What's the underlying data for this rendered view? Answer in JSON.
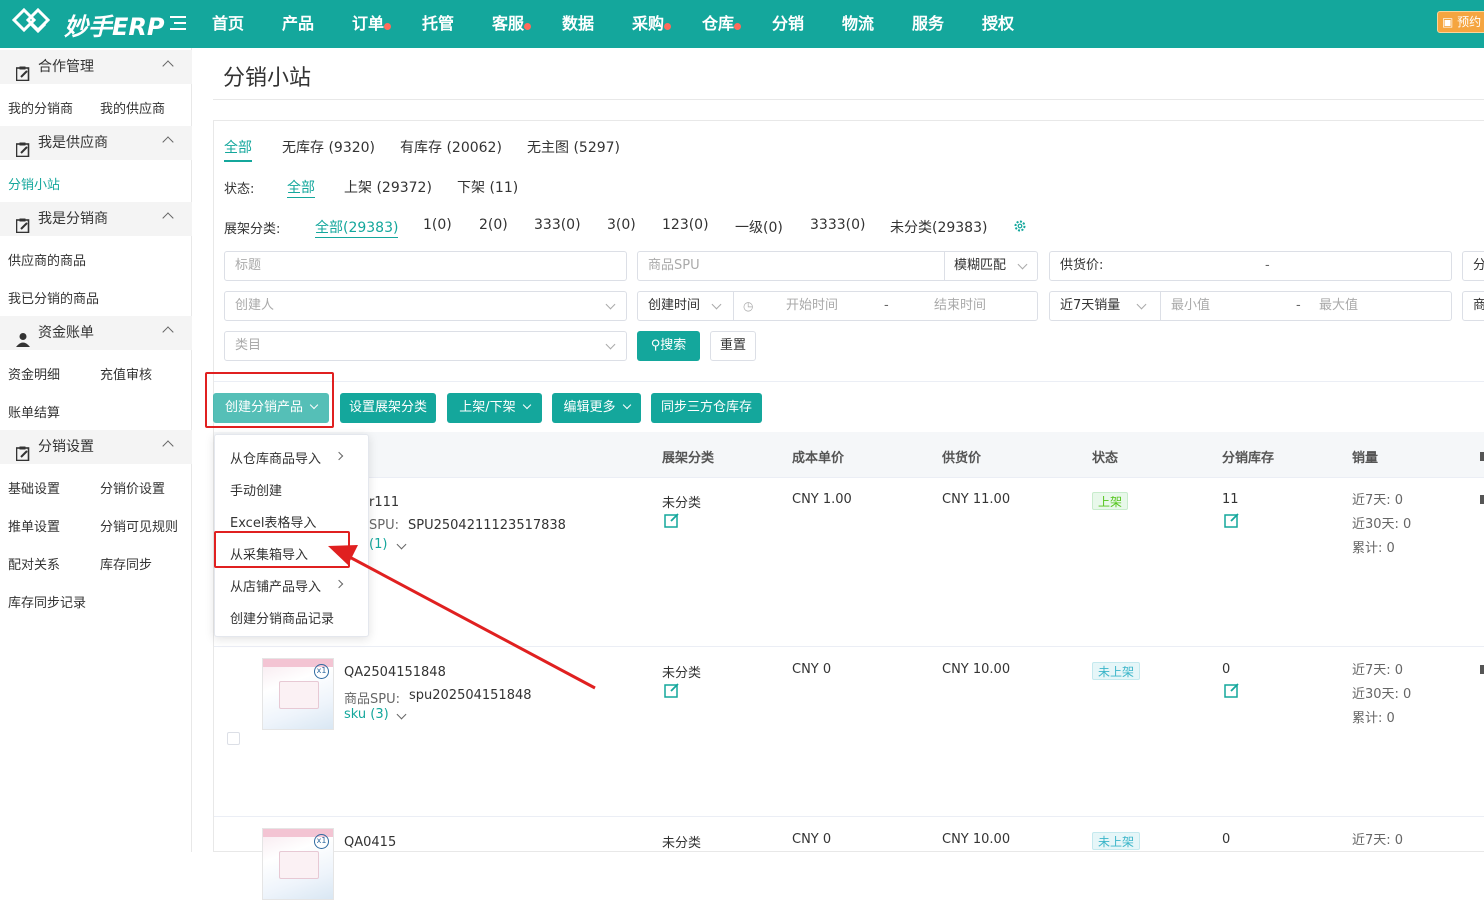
{
  "app": {
    "brand": "妙手ERP",
    "warn_label": "预约"
  },
  "nav": [
    {
      "label": "首页",
      "dot": false
    },
    {
      "label": "产品",
      "dot": false
    },
    {
      "label": "订单",
      "dot": true
    },
    {
      "label": "托管",
      "dot": false
    },
    {
      "label": "客服",
      "dot": true
    },
    {
      "label": "数据",
      "dot": false
    },
    {
      "label": "采购",
      "dot": true
    },
    {
      "label": "仓库",
      "dot": true
    },
    {
      "label": "分销",
      "dot": false
    },
    {
      "label": "物流",
      "dot": false
    },
    {
      "label": "服务",
      "dot": false
    },
    {
      "label": "授权",
      "dot": false
    }
  ],
  "sidebar": {
    "sections": [
      {
        "title": "合作管理",
        "icon": "clipboard-icon",
        "items": [
          "我的分销商",
          "我的供应商"
        ]
      },
      {
        "title": "我是供应商",
        "icon": "clipboard-icon",
        "items": [
          "分销小站"
        ]
      },
      {
        "title": "我是分销商",
        "icon": "clipboard-icon",
        "items": [
          "供应商的商品",
          "我已分销的商品"
        ]
      },
      {
        "title": "资金账单",
        "icon": "user-icon",
        "items": [
          "资金明细",
          "充值审核",
          "账单结算"
        ]
      },
      {
        "title": "分销设置",
        "icon": "clipboard-icon",
        "items": [
          "基础设置",
          "分销价设置",
          "推单设置",
          "分销可见规则",
          "配对关系",
          "库存同步",
          "库存同步记录"
        ]
      }
    ],
    "active": "分销小站"
  },
  "page": {
    "title": "分销小站"
  },
  "tabs": [
    "全部",
    "无库存 (9320)",
    "有库存 (20062)",
    "无主图 (5297)"
  ],
  "status_filter": {
    "label": "状态:",
    "options": [
      "全部",
      "上架 (29372)",
      "下架 (11)"
    ]
  },
  "category_filter": {
    "label": "展架分类:",
    "options": [
      "全部(29383)",
      "1(0)",
      "2(0)",
      "333(0)",
      "3(0)",
      "123(0)",
      "一级(0)",
      "3333(0)",
      "未分类(29383)"
    ]
  },
  "filters": {
    "title_ph": "标题",
    "spu_ph": "商品SPU",
    "match_mode": "模糊匹配",
    "price_label": "供货价:",
    "price_sep": "-",
    "cut_label": "分",
    "creator_ph": "创建人",
    "time_mode": "创建时间",
    "start_ph": "开始时间",
    "time_sep": "-",
    "end_ph": "结束时间",
    "sales_mode": "近7天销量",
    "min_ph": "最小值",
    "range_sep": "-",
    "max_ph": "最大值",
    "cut2_label": "商",
    "category_ph": "类目",
    "search_btn": "搜索",
    "reset_btn": "重置"
  },
  "actions": {
    "create": "创建分销产品",
    "set_category": "设置展架分类",
    "shelf": "上架/下架",
    "edit_more": "编辑更多",
    "sync": "同步三方仓库存"
  },
  "columns": [
    "展架分类",
    "成本单价",
    "供货价",
    "状态",
    "分销库存",
    "销量"
  ],
  "rows": [
    {
      "name": "r111",
      "spu_label": "SPU:",
      "spu": "SPU2504211123517838",
      "sku": "(1)",
      "category": "未分类",
      "cost": "CNY 1.00",
      "price": "CNY 11.00",
      "status": "上架",
      "stock": "11",
      "s7": "近7天: 0",
      "s30": "近30天: 0",
      "total": "累计: 0"
    },
    {
      "name": "QA2504151848",
      "spu_label": "商品SPU:",
      "spu": "spu202504151848",
      "sku": "sku (3)",
      "category": "未分类",
      "cost": "CNY 0",
      "price": "CNY 10.00",
      "status": "未上架",
      "stock": "0",
      "s7": "近7天: 0",
      "s30": "近30天: 0",
      "total": "累计: 0"
    },
    {
      "name": "QA0415",
      "category": "未分类",
      "cost": "CNY 0",
      "price": "CNY 10.00",
      "status": "未上架",
      "stock": "0",
      "s7": "近7天: 0"
    }
  ],
  "dropdown": [
    "从仓库商品导入",
    "手动创建",
    "Excel表格导入",
    "从采集箱导入",
    "从店铺产品导入",
    "创建分销商品记录"
  ],
  "colors": {
    "accent": "#14a79c",
    "annotation": "#e02020",
    "warn": "#f5a540"
  }
}
